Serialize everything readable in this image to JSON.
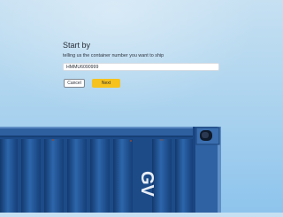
{
  "form": {
    "title": "Start by",
    "subtitle": "telling us the container number you want to ship",
    "container_number_value": "HMMU6090999",
    "cancel_label": "Cancel",
    "next_label": "Next"
  },
  "background": {
    "container_marking": "GV"
  },
  "colors": {
    "next_button": "#f6c21d",
    "container_blue": "#1f4f8e",
    "sky": "#a8d3ef"
  }
}
